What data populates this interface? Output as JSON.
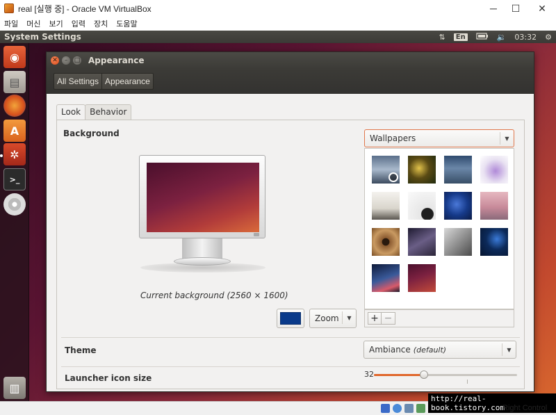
{
  "host": {
    "title": "real [실행 중] - Oracle VM VirtualBox",
    "menu": [
      "파일",
      "머신",
      "보기",
      "입력",
      "장치",
      "도움말"
    ],
    "win_minimize": "─",
    "win_maximize": "☐",
    "win_close": "✕",
    "right_control": "Right Control",
    "watermark": "http://real-book.tistory.com"
  },
  "panel": {
    "title": "System Settings",
    "keyboard": "En",
    "clock": "03:32",
    "icons": [
      "transfer-icon",
      "keyboard-icon",
      "battery-icon",
      "volume-icon",
      "gear-icon"
    ]
  },
  "launcher": {
    "icons": [
      "ubuntu-logo-icon",
      "files-icon",
      "firefox-icon",
      "software-center-icon",
      "system-settings-icon",
      "terminal-icon",
      "disc-icon",
      "trash-icon"
    ]
  },
  "window": {
    "title": "Appearance",
    "breadcrumbs": [
      "All Settings",
      "Appearance"
    ],
    "tabs": [
      "Look",
      "Behavior"
    ],
    "background_label": "Background",
    "wallpaper_source": "Wallpapers",
    "caption": "Current background (2560 × 1600)",
    "color_value": "#0a3a8a",
    "zoom_label": "Zoom",
    "add_label": "+",
    "remove_label": "−",
    "theme_label": "Theme",
    "theme_value": "Ambiance",
    "theme_default": "(default)",
    "launcher_label": "Launcher icon size",
    "launcher_value": "32",
    "launcher_fraction": 0.35
  },
  "colors": {
    "accent": "#e0662a",
    "panel": "#3c3b37"
  }
}
